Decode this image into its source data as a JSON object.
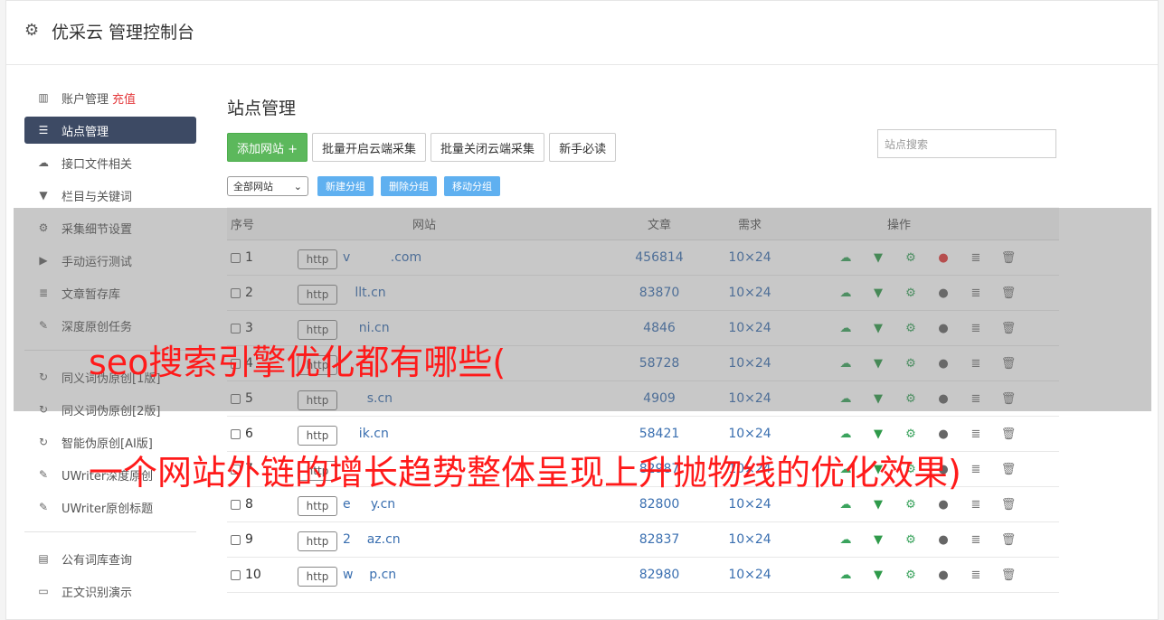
{
  "header": {
    "title": "优采云 管理控制台",
    "icon": "gear-icon"
  },
  "sidebar": {
    "items": [
      {
        "label": "账户管理",
        "badge": "充值",
        "icon": "bar-chart-icon"
      },
      {
        "label": "站点管理",
        "icon": "server-icon",
        "active": true
      },
      {
        "label": "接口文件相关",
        "icon": "cloud-upload-icon"
      },
      {
        "label": "栏目与关键词",
        "icon": "filter-icon"
      },
      {
        "label": "采集细节设置",
        "icon": "cogs-icon"
      },
      {
        "label": "手动运行测试",
        "icon": "play-circle-icon"
      },
      {
        "label": "文章暂存库",
        "icon": "database-icon"
      },
      {
        "label": "深度原创任务",
        "icon": "edit-icon"
      },
      {
        "label": "同义词伪原创[1版]",
        "icon": "refresh-icon"
      },
      {
        "label": "同义词伪原创[2版]",
        "icon": "refresh-icon"
      },
      {
        "label": "智能伪原创[AI版]",
        "icon": "refresh-icon"
      },
      {
        "label": "UWriter深度原创",
        "icon": "edit-icon"
      },
      {
        "label": "UWriter原创标题",
        "icon": "edit-icon"
      },
      {
        "label": "公有词库查询",
        "icon": "book-icon"
      },
      {
        "label": "正文识别演示",
        "icon": "monitor-icon"
      }
    ]
  },
  "main": {
    "title": "站点管理",
    "toolbar": {
      "add_site": "添加网站 +",
      "batch_on": "批量开启云端采集",
      "batch_off": "批量关闭云端采集",
      "newbie": "新手必读",
      "search_placeholder": "站点搜索"
    },
    "group": {
      "select_value": "全部网站",
      "new_group": "新建分组",
      "delete_group": "删除分组",
      "move_group": "移动分组"
    },
    "table": {
      "headers": {
        "no": "序号",
        "site": "网站",
        "articles": "文章",
        "demand": "需求",
        "ops": "操作"
      },
      "http_label": "http",
      "rows": [
        {
          "no": "1",
          "domain": "v          .com",
          "articles": "456814",
          "demand": "10×24"
        },
        {
          "no": "2",
          "domain": "   llt.cn",
          "articles": "83870",
          "demand": "10×24"
        },
        {
          "no": "3",
          "domain": "    ni.cn",
          "articles": "4846",
          "demand": "10×24"
        },
        {
          "no": "4",
          "domain": "      ",
          "articles": "58728",
          "demand": "10×24"
        },
        {
          "no": "5",
          "domain": "      s.cn",
          "articles": "4909",
          "demand": "10×24"
        },
        {
          "no": "6",
          "domain": "    ik.cn",
          "articles": "58421",
          "demand": "10×24"
        },
        {
          "no": "7",
          "domain": "      ",
          "articles": "82987",
          "demand": "10×24"
        },
        {
          "no": "8",
          "domain": "e     y.cn",
          "articles": "82800",
          "demand": "10×24"
        },
        {
          "no": "9",
          "domain": "2    az.cn",
          "articles": "82837",
          "demand": "10×24"
        },
        {
          "no": "10",
          "domain": "w    p.cn",
          "articles": "82980",
          "demand": "10×24"
        }
      ]
    }
  },
  "overlay": {
    "line1": "seo搜索引擎优化都有哪些(",
    "line2": "一个网站外链的增长趋势整体呈现上升抛物线的优化效果)"
  }
}
